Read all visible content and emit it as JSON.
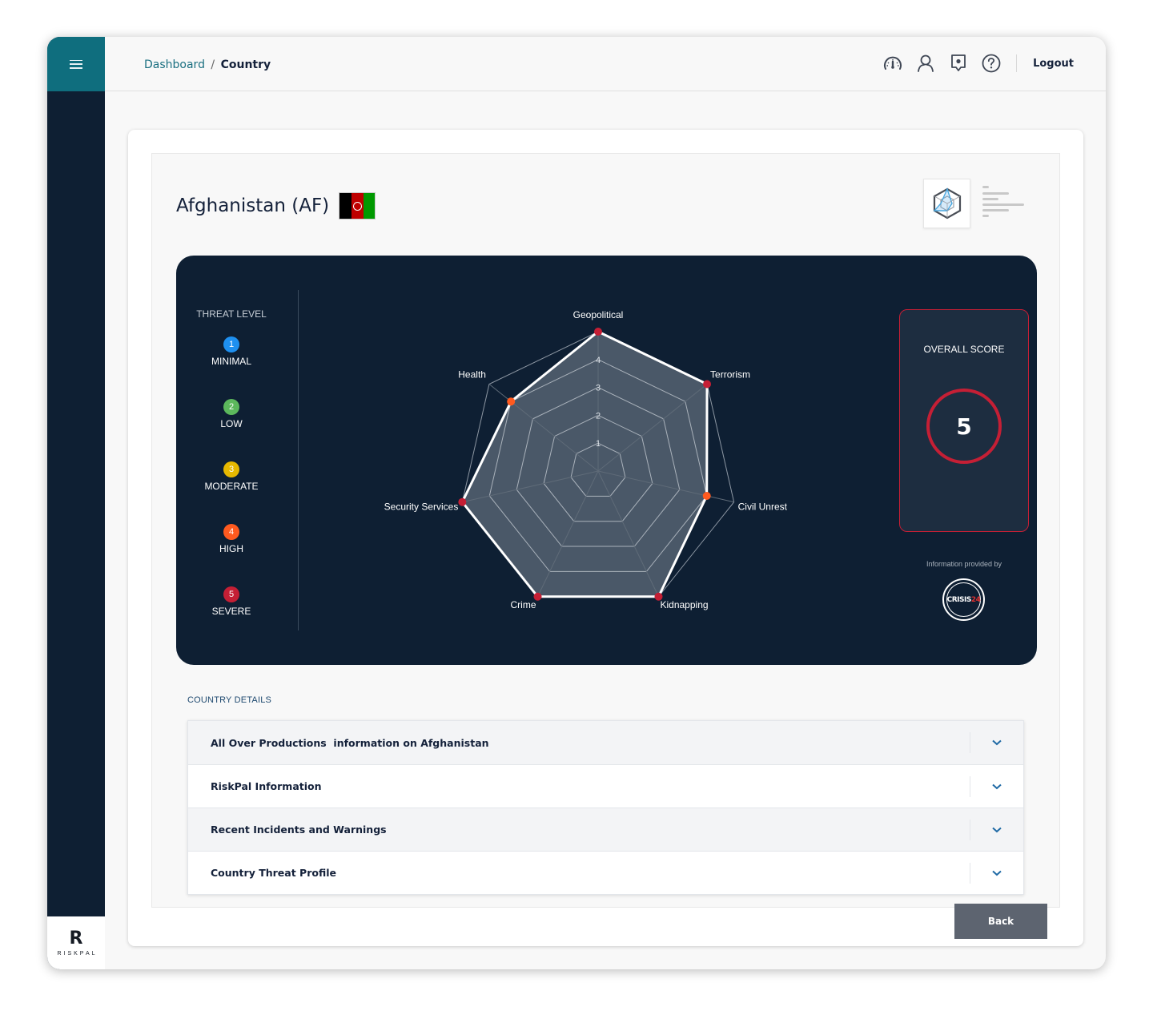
{
  "header": {
    "breadcrumb": {
      "parent": "Dashboard",
      "separator": "/",
      "current": "Country"
    },
    "icons": [
      "dashboard-gauge-icon",
      "user-profile-icon",
      "location-pin-icon",
      "help-icon"
    ],
    "logout_label": "Logout"
  },
  "sidebar": {
    "menu_icon": "hamburger-menu-icon",
    "logo_mark": "R",
    "logo_text": "RISKPAL"
  },
  "country": {
    "title": "Afghanistan (AF)",
    "flag_colors": [
      "#000000",
      "#be0000",
      "#009900"
    ]
  },
  "view_toggle": {
    "radar_icon": "radar-chart-icon",
    "list_icon": "list-view-icon",
    "selected": "radar"
  },
  "threat_legend": {
    "title": "THREAT LEVEL",
    "levels": [
      {
        "value": "1",
        "label": "MINIMAL",
        "color": "#1e90f0"
      },
      {
        "value": "2",
        "label": "LOW",
        "color": "#5cb85c"
      },
      {
        "value": "3",
        "label": "MODERATE",
        "color": "#e6b800"
      },
      {
        "value": "4",
        "label": "HIGH",
        "color": "#ff5a1f"
      },
      {
        "value": "5",
        "label": "SEVERE",
        "color": "#c51f35"
      }
    ]
  },
  "chart_data": {
    "type": "radar",
    "title": "",
    "categories": [
      "Geopolitical",
      "Terrorism",
      "Civil Unrest",
      "Kidnapping",
      "Crime",
      "Security Services",
      "Health"
    ],
    "values": [
      5,
      5,
      4,
      5,
      5,
      5,
      4
    ],
    "rlim": [
      0,
      5
    ],
    "ring_tick_labels": [
      "1",
      "2",
      "3",
      "4"
    ],
    "grid": true,
    "point_colors_by_value": {
      "4": "#ff5a1f",
      "5": "#c51f35"
    }
  },
  "overall_score": {
    "title": "OVERALL SCORE",
    "value": "5",
    "color": "#c51f35"
  },
  "provider": {
    "caption": "Information provided by",
    "logo_word": "CRISIS",
    "logo_number": "24"
  },
  "country_details": {
    "label": "COUNTRY DETAILS",
    "sections": [
      {
        "title": "All Over Productions  information on Afghanistan"
      },
      {
        "title": "RiskPal Information"
      },
      {
        "title": "Recent Incidents and Warnings"
      },
      {
        "title": "Country Threat Profile"
      }
    ]
  },
  "actions": {
    "back_label": "Back"
  }
}
